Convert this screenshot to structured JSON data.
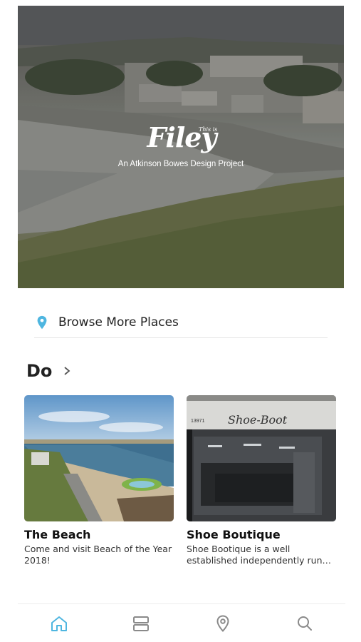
{
  "hero": {
    "this_is": "This is",
    "title": "Filey",
    "subtitle": "An Atkinson Bowes Design Project"
  },
  "browse": {
    "icon": "location-pin-icon",
    "label": "Browse More Places"
  },
  "section": {
    "title": "Do"
  },
  "cards": [
    {
      "title": "The Beach",
      "description": "Come and visit Beach of the Year 2018!",
      "image": "beach-photo"
    },
    {
      "title": "Shoe Boutique",
      "description": "Shoe Bootique is a well established independently run shoe shop",
      "image": "shop-front-photo",
      "sign_text": "Shoe-Boot",
      "sign_number": "13971"
    }
  ],
  "tabbar": {
    "items": [
      {
        "icon": "home-icon",
        "active": true
      },
      {
        "icon": "list-icon",
        "active": false
      },
      {
        "icon": "map-pin-icon",
        "active": false
      },
      {
        "icon": "search-icon",
        "active": false
      }
    ]
  },
  "colors": {
    "accent": "#4fb6e0",
    "tab_inactive": "#8a8a8a",
    "divider": "#e6e6e6"
  }
}
